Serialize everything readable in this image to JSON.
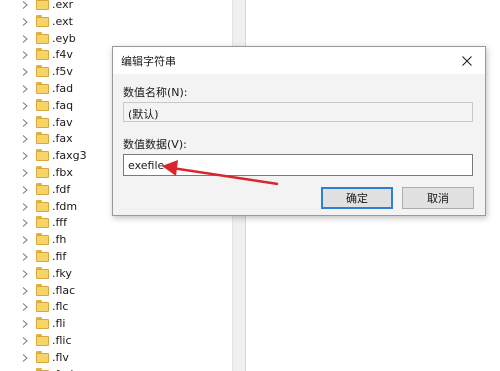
{
  "tree": {
    "items": [
      {
        "label": ".exr"
      },
      {
        "label": ".ext"
      },
      {
        "label": ".eyb"
      },
      {
        "label": ".f4v"
      },
      {
        "label": ".f5v"
      },
      {
        "label": ".fad"
      },
      {
        "label": ".faq"
      },
      {
        "label": ".fav"
      },
      {
        "label": ".fax"
      },
      {
        "label": ".faxg3"
      },
      {
        "label": ".fbx"
      },
      {
        "label": ".fdf"
      },
      {
        "label": ".fdm"
      },
      {
        "label": ".fff"
      },
      {
        "label": ".fh"
      },
      {
        "label": ".fif"
      },
      {
        "label": ".fky"
      },
      {
        "label": ".flac"
      },
      {
        "label": ".flc"
      },
      {
        "label": ".fli"
      },
      {
        "label": ".flic"
      },
      {
        "label": ".flv"
      },
      {
        "label": ".fnd"
      }
    ]
  },
  "dialog": {
    "title": "编辑字符串",
    "name_label": "数值名称(N):",
    "name_value": "(默认)",
    "data_label": "数值数据(V):",
    "data_value": "exefile",
    "ok_label": "确定",
    "cancel_label": "取消"
  },
  "colors": {
    "folder": "#f7d467",
    "arrow": "#d9262c",
    "accent": "#2f7fd4"
  }
}
